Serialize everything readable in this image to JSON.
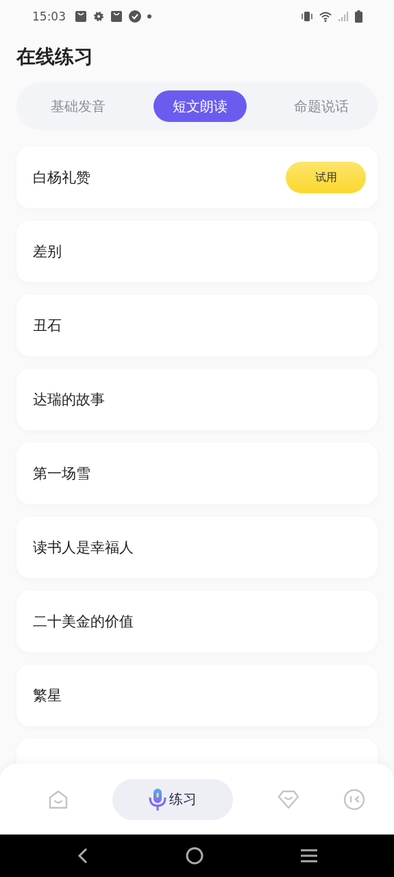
{
  "status_bar": {
    "time": "15:03"
  },
  "title": "在线练习",
  "tabs": [
    {
      "label": "基础发音",
      "selected": false
    },
    {
      "label": "短文朗读",
      "selected": true
    },
    {
      "label": "命题说话",
      "selected": false
    }
  ],
  "items": [
    {
      "kind": "full",
      "title": "白杨礼赞",
      "badge": "试用"
    },
    {
      "kind": "full",
      "title": "差别"
    },
    {
      "kind": "full",
      "title": "丑石"
    },
    {
      "kind": "full",
      "title": "达瑞的故事"
    },
    {
      "kind": "full",
      "title": "第一场雪"
    },
    {
      "kind": "full",
      "title": "读书人是幸福人"
    },
    {
      "kind": "full",
      "title": "二十美金的价值"
    },
    {
      "kind": "full",
      "title": "繁星"
    },
    {
      "kind": "cut"
    }
  ],
  "bottom_nav": [
    {
      "selected": false
    },
    {
      "selected": true,
      "label": "练习"
    },
    {
      "selected": false
    },
    {
      "selected": false
    }
  ]
}
